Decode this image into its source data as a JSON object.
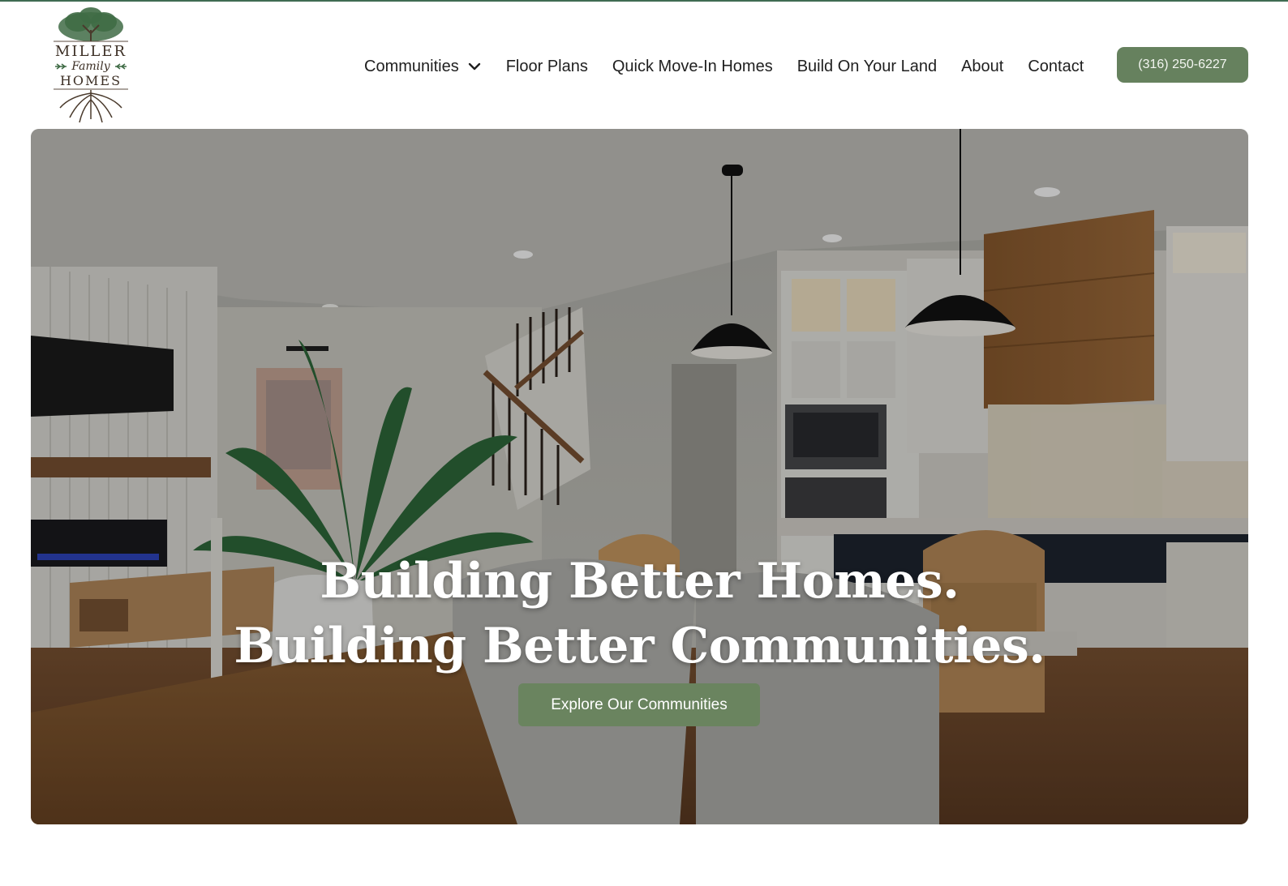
{
  "brand": {
    "logo_line1": "MILLER",
    "logo_line2": "Family",
    "logo_line3": "HOMES",
    "green": "#66815e",
    "dark_green": "#3f6b52"
  },
  "nav": {
    "items": [
      {
        "label": "Communities",
        "icon": "chevron-down-icon"
      },
      {
        "label": "Floor Plans"
      },
      {
        "label": "Quick Move-In Homes"
      },
      {
        "label": "Build On Your Land"
      },
      {
        "label": "About"
      },
      {
        "label": "Contact"
      }
    ],
    "phone": "(316) 250-6227"
  },
  "hero": {
    "headline_line1": "Building Better Homes.",
    "headline_line2": "Building Better Communities.",
    "cta_label": "Explore Our Communities"
  }
}
